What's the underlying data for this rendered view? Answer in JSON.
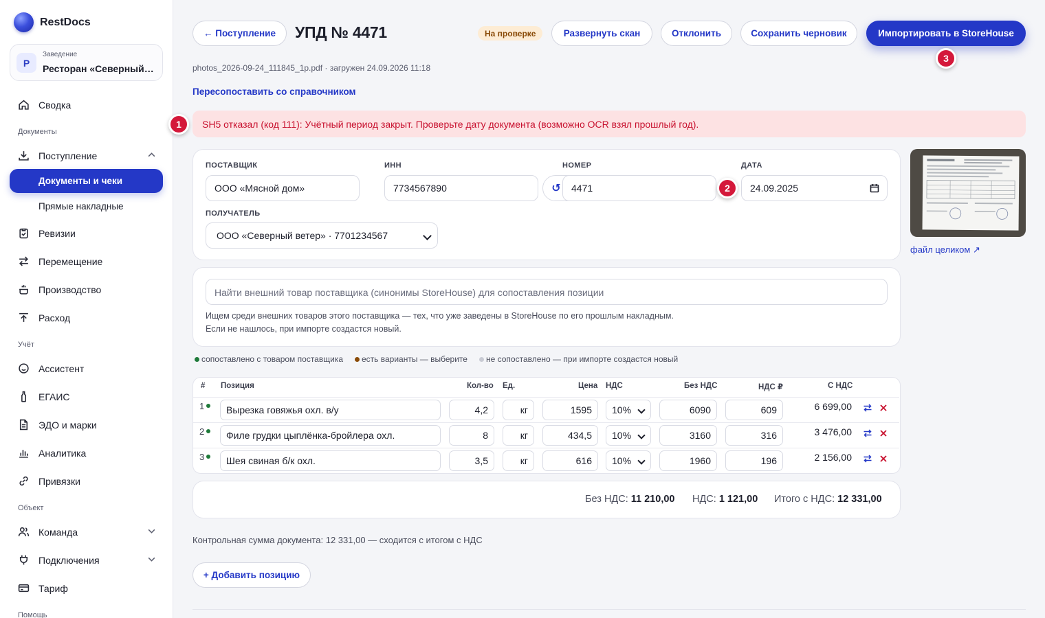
{
  "brand": {
    "name": "RestDocs"
  },
  "venue": {
    "label": "Заведение",
    "avatar": "Р",
    "name": "Ресторан «Северный ветер»"
  },
  "sidebar": {
    "summary": "Сводка",
    "section_documents": "Документы",
    "incoming": "Поступление",
    "incoming_docs": "Документы и чеки",
    "incoming_direct": "Прямые накладные",
    "revisions": "Ревизии",
    "transfer": "Перемещение",
    "production": "Производство",
    "expense": "Расход",
    "section_accounting": "Учёт",
    "assistant": "Ассистент",
    "egais": "ЕГАИС",
    "edo": "ЭДО и марки",
    "analytics": "Аналитика",
    "bindings": "Привязки",
    "section_object": "Объект",
    "team": "Команда",
    "connections": "Подключения",
    "tariff": "Тариф",
    "section_help": "Помощь"
  },
  "header": {
    "back_label": "← Поступление",
    "title": "УПД № 4471",
    "status": "На проверке",
    "expand_scan": "Развернуть скан",
    "reject": "Отклонить",
    "save_draft": "Сохранить черновик",
    "import": "Импортировать в StoreHouse"
  },
  "markers": {
    "m1": "1",
    "m2": "2",
    "m3": "3"
  },
  "file_meta": "photos_2026-09-24_111845_1p.pdf · загружен 24.09.2026 11:18",
  "remap_link": "Пересопоставить со справочником",
  "alert": "SH5 отказал (код 111): Учётный период закрыт. Проверьте дату документа (возможно OCR взял прошлый год).",
  "form": {
    "supplier_label": "ПОСТАВЩИК",
    "supplier": "ООО «Мясной дом»",
    "inn_label": "ИНН",
    "inn": "7734567890",
    "number_label": "НОМЕР",
    "number": "4471",
    "refresh_glyph": "↺",
    "date_label": "ДАТА",
    "date": "24.09.2025",
    "recipient_label": "ПОЛУЧАТЕЛЬ",
    "recipient": "ООО «Северный ветер» · 7701234567"
  },
  "scan": {
    "link": "файл целиком ↗"
  },
  "search": {
    "placeholder": "Найти внешний товар поставщика (синонимы StoreHouse) для сопоставления позиции",
    "hint": "Ищем среди внешних товаров этого поставщика — тех, что уже заведены в StoreHouse по его прошлым накладным. Если не нашлось, при импорте создастся новый."
  },
  "legend": {
    "matched": "сопоставлено с товаром поставщика",
    "variants": "есть варианты — выберите",
    "unmatched": "не сопоставлено — при импорте создастся новый",
    "colors": {
      "matched": "#1f7a3a",
      "variants": "#8a4b08",
      "unmatched": "#c9cbd4"
    }
  },
  "table": {
    "headers": {
      "num": "#",
      "name": "Позиция",
      "qty": "Кол-во",
      "unit": "Ед.",
      "price": "Цена",
      "vat": "НДС",
      "net": "Без НДС",
      "vat_sum": "НДС ₽",
      "gross": "С НДС"
    },
    "rows": [
      {
        "num": "1",
        "name": "Вырезка говяжья охл. в/у",
        "qty": "4,2",
        "unit": "кг",
        "price": "1595",
        "vat": "10%",
        "net": "6090",
        "vat_sum": "609",
        "gross": "6 699,00"
      },
      {
        "num": "2",
        "name": "Филе грудки цыплёнка-бройлера охл.",
        "qty": "8",
        "unit": "кг",
        "price": "434,5",
        "vat": "10%",
        "net": "3160",
        "vat_sum": "316",
        "gross": "3 476,00"
      },
      {
        "num": "3",
        "name": "Шея свиная б/к охл.",
        "qty": "3,5",
        "unit": "кг",
        "price": "616",
        "vat": "10%",
        "net": "1960",
        "vat_sum": "196",
        "gross": "2 156,00"
      }
    ]
  },
  "totals": {
    "net_label": "Без НДС:",
    "net": "11 210,00",
    "vat_label": "НДС:",
    "vat": "1 121,00",
    "gross_label": "Итого с НДС:",
    "gross": "12 331,00"
  },
  "checksum": "Контрольная сумма документа: 12 331,00 — сходится с итогом с НДС",
  "add_item": "+ Добавить позицию"
}
